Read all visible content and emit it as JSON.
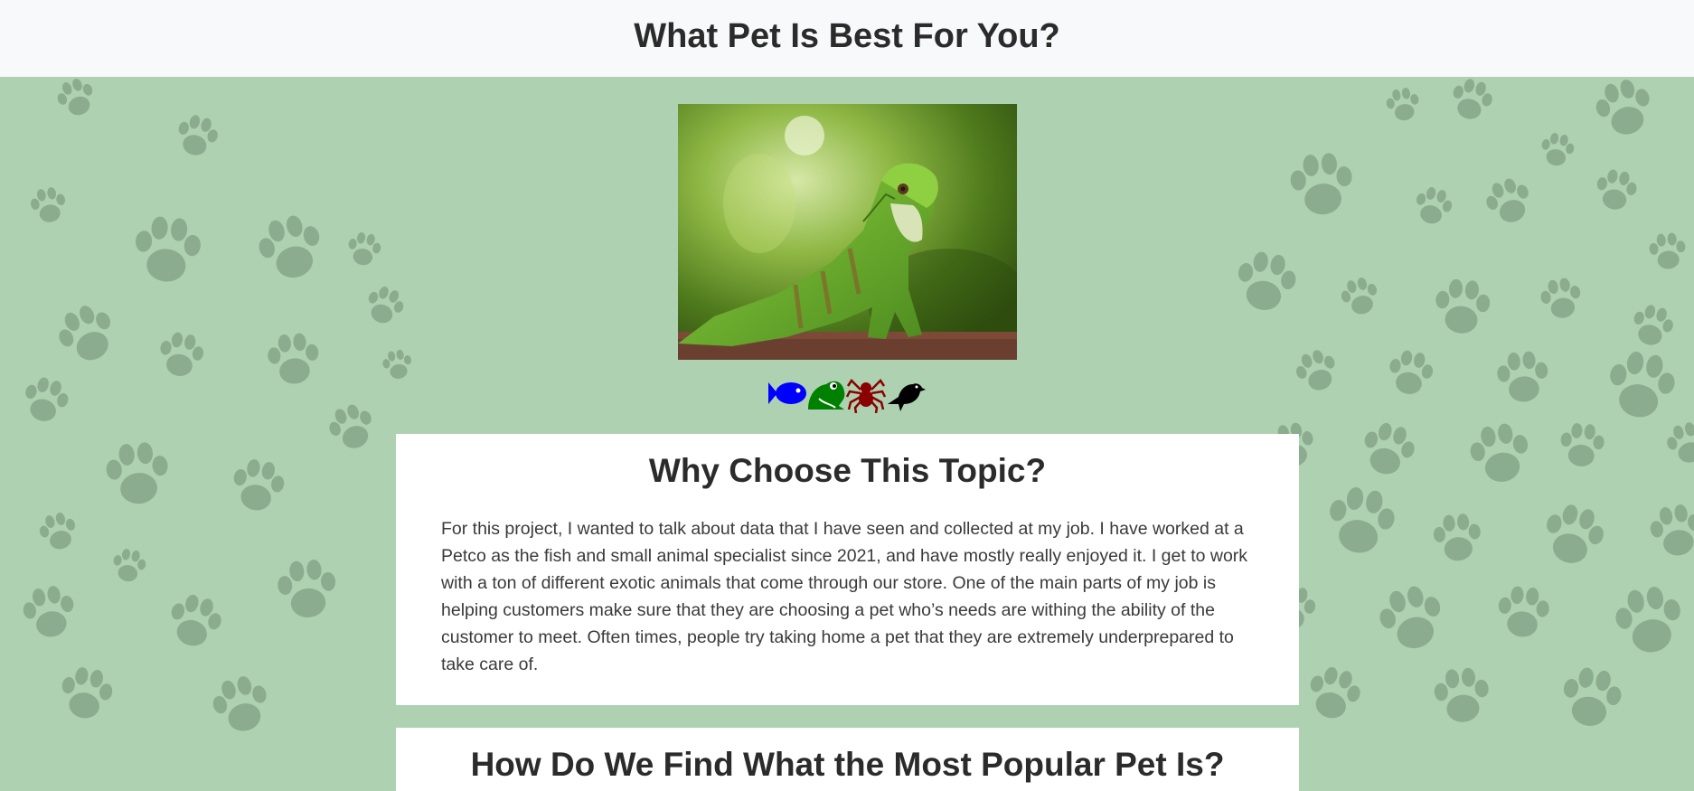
{
  "header": {
    "title": "What Pet Is Best For You?"
  },
  "hero": {
    "image_alt": "Green iguana"
  },
  "icons": [
    "fish-icon",
    "frog-icon",
    "spider-icon",
    "bird-icon"
  ],
  "colors": {
    "fish": "#0000ff",
    "frog": "#008000",
    "spider": "#8b0000",
    "bird": "#000000",
    "background": "#aed1b1",
    "header": "#f8f9fa"
  },
  "sections": [
    {
      "title": "Why Choose This Topic?",
      "body": "For this project, I wanted to talk about data that I have seen and collected at my job. I have worked at a Petco as the fish and small animal specialist since 2021, and have mostly really enjoyed it. I get to work with a ton of different exotic animals that come through our store. One of the main parts of my job is helping customers make sure that they are choosing a pet who’s needs are withing the ability of the customer to meet. Often times, people try taking home a pet that they are extremely underprepared to take care of."
    },
    {
      "title": "How Do We Find What the Most Popular Pet Is?"
    }
  ]
}
